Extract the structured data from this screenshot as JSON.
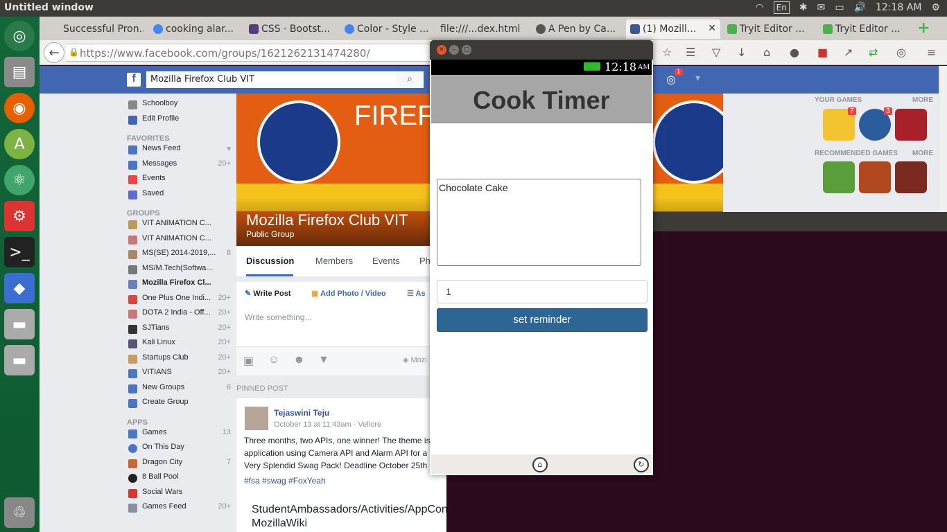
{
  "topbar": {
    "title": "Untitled window",
    "lang": "En",
    "time": "12:18 AM"
  },
  "tabs": [
    {
      "label": "Successful Pron..."
    },
    {
      "label": "cooking alar..."
    },
    {
      "label": "CSS · Bootst..."
    },
    {
      "label": "Color - Style ..."
    },
    {
      "label": "file:///...dex.html"
    },
    {
      "label": "A Pen by Ca..."
    },
    {
      "label": "(1) Mozill..."
    },
    {
      "label": "Tryit Editor ..."
    },
    {
      "label": "Tryit Editor ..."
    }
  ],
  "nav": {
    "url_host": "https://www.facebook.com",
    "url_path": "/groups/1621262131474280/"
  },
  "fb": {
    "search": "Mozilla Firefox Club VIT",
    "left": [
      {
        "label": "Schoolboy",
        "count": ""
      },
      {
        "label": "Edit Profile",
        "count": ""
      }
    ],
    "favorites_header": "FAVORITES",
    "favorites": [
      {
        "label": "News Feed",
        "count": ""
      },
      {
        "label": "Messages",
        "count": "20+"
      },
      {
        "label": "Events",
        "count": ""
      },
      {
        "label": "Saved",
        "count": ""
      }
    ],
    "groups_header": "GROUPS",
    "groups": [
      {
        "label": "VIT ANIMATION C...",
        "count": ""
      },
      {
        "label": "VIT ANIMATION C...",
        "count": ""
      },
      {
        "label": "MS(SE) 2014-2019,...",
        "count": "8"
      },
      {
        "label": "MS/M.Tech(Softwa...",
        "count": ""
      },
      {
        "label": "Mozilla Firefox Cl...",
        "count": ""
      },
      {
        "label": "One Plus One Indi...",
        "count": "20+"
      },
      {
        "label": "DOTA 2 India - Off...",
        "count": "20+"
      },
      {
        "label": "SJTians",
        "count": "20+"
      },
      {
        "label": "Kali Linux",
        "count": "20+"
      },
      {
        "label": "Startups Club",
        "count": "20+"
      },
      {
        "label": "VITIANS",
        "count": "20+"
      },
      {
        "label": "New Groups",
        "count": "6"
      },
      {
        "label": "Create Group",
        "count": ""
      }
    ],
    "apps_header": "APPS",
    "apps": [
      {
        "label": "Games",
        "count": "13"
      },
      {
        "label": "On This Day",
        "count": ""
      },
      {
        "label": "Dragon City",
        "count": "7"
      },
      {
        "label": "8 Ball Pool",
        "count": ""
      },
      {
        "label": "Social Wars",
        "count": ""
      },
      {
        "label": "Games Feed",
        "count": "20+"
      }
    ],
    "cover_text": "FIREFOX AMB",
    "group_name": "Mozilla Firefox Club VIT",
    "group_type": "Public Group",
    "group_tabs": [
      "Discussion",
      "Members",
      "Events",
      "Ph"
    ],
    "composer": {
      "write_post": "Write Post",
      "add_photo": "Add Photo / Video",
      "more": "As",
      "placeholder": "Write something...",
      "privacy": "Mozi"
    },
    "pinned_header": "PINNED POST",
    "post": {
      "author": "Tejaswini Teju",
      "meta": "October 13 at 11:43am · Vellore",
      "line1": "Three months, two APIs, one winner! The theme is",
      "line2": "application using Camera API and Alarm API for a",
      "line3": "Very Splendid Swag Pack! Deadline October 25th",
      "tags": "#fsa #swag #FoxYeah",
      "link_title": "StudentAmbassadors/Activities/AppCon",
      "link_site": "MozillaWiki"
    },
    "right": {
      "your_games": "YOUR GAMES",
      "more1": "MORE",
      "recommended": "RECOMMENDED GAMES",
      "more2": "MORE",
      "badge1": "7",
      "badge2": "3",
      "notif": "1"
    }
  },
  "app": {
    "status_time": "12:18",
    "status_ampm": "AM",
    "title": "Cook Timer",
    "recipe": "Chocolate Cake",
    "minutes": "1",
    "button": "set reminder"
  }
}
